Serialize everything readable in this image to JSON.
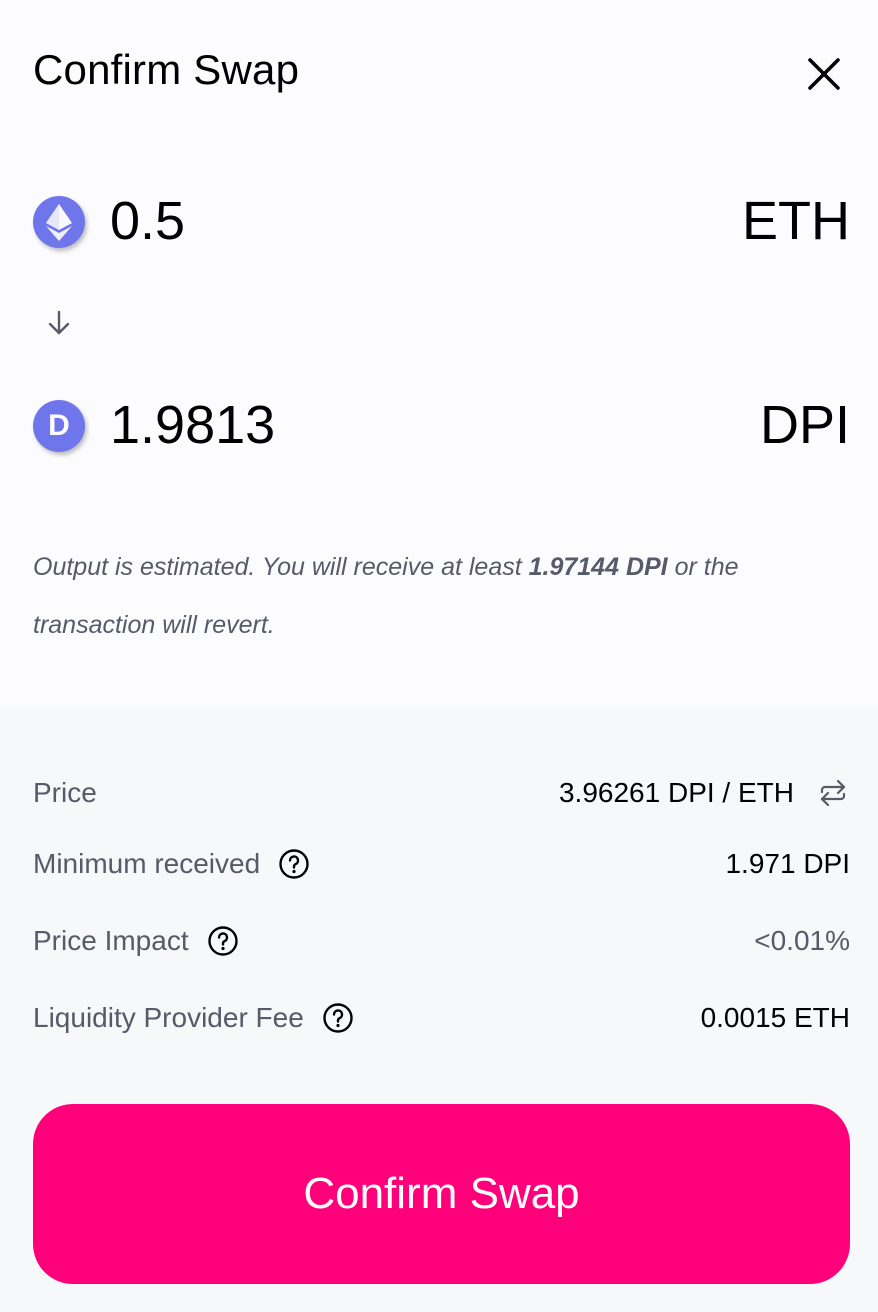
{
  "modal": {
    "title": "Confirm Swap",
    "close_icon": "close-icon"
  },
  "input_token": {
    "amount": "0.5",
    "symbol": "ETH",
    "icon": "eth-icon"
  },
  "arrow_icon": "arrow-down-icon",
  "output_token": {
    "amount": "1.9813",
    "symbol": "DPI",
    "icon": "dpi-icon",
    "icon_letter": "D"
  },
  "note": {
    "prefix": "Output is estimated. You will receive at least ",
    "amount": "1.97144 DPI",
    "suffix": " or the transaction will revert."
  },
  "details": {
    "price": {
      "label": "Price",
      "value": "3.96261 DPI / ETH",
      "icon": "swap-arrows-icon"
    },
    "minimum_received": {
      "label": "Minimum received",
      "value": "1.971 DPI",
      "icon": "question-icon"
    },
    "price_impact": {
      "label": "Price Impact",
      "value": "<0.01%",
      "icon": "question-icon"
    },
    "lp_fee": {
      "label": "Liquidity Provider Fee",
      "value": "0.0015 ETH",
      "icon": "question-icon"
    }
  },
  "confirm_button": {
    "label": "Confirm Swap"
  },
  "colors": {
    "accent": "#ff007a",
    "token_icon": "#6f75ea",
    "muted_text": "#565a69"
  }
}
